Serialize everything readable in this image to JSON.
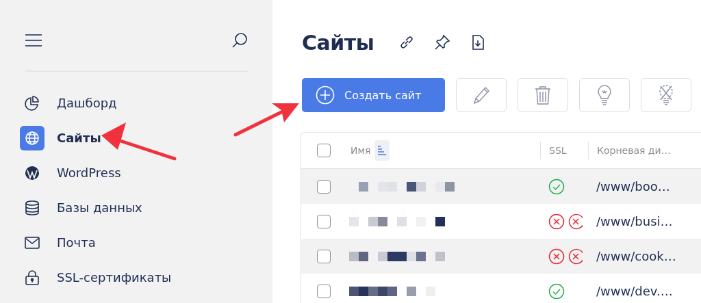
{
  "sidebar": {
    "items": [
      {
        "label": "Дашборд",
        "selected": false
      },
      {
        "label": "Сайты",
        "selected": true
      },
      {
        "label": "WordPress",
        "selected": false
      },
      {
        "label": "Базы данных",
        "selected": false
      },
      {
        "label": "Почта",
        "selected": false
      },
      {
        "label": "SSL-сертификаты",
        "selected": false
      }
    ]
  },
  "page": {
    "title": "Сайты"
  },
  "toolbar": {
    "create_button": "Создать сайт"
  },
  "table": {
    "select_all_checked": false,
    "columns": [
      {
        "label": "Имя",
        "sorted": true
      },
      {
        "label": "SSL",
        "sorted": false
      },
      {
        "label": "Корневая ди…",
        "sorted": false
      }
    ],
    "rows": [
      {
        "checked": false,
        "kind": "secure",
        "root": "/www/boo…"
      },
      {
        "checked": false,
        "kind": "insecure",
        "root": "/www/busi…"
      },
      {
        "checked": false,
        "kind": "insecure",
        "root": "/www/cook…"
      },
      {
        "checked": false,
        "kind": "secure",
        "root": "/www/dev.…"
      }
    ]
  }
}
